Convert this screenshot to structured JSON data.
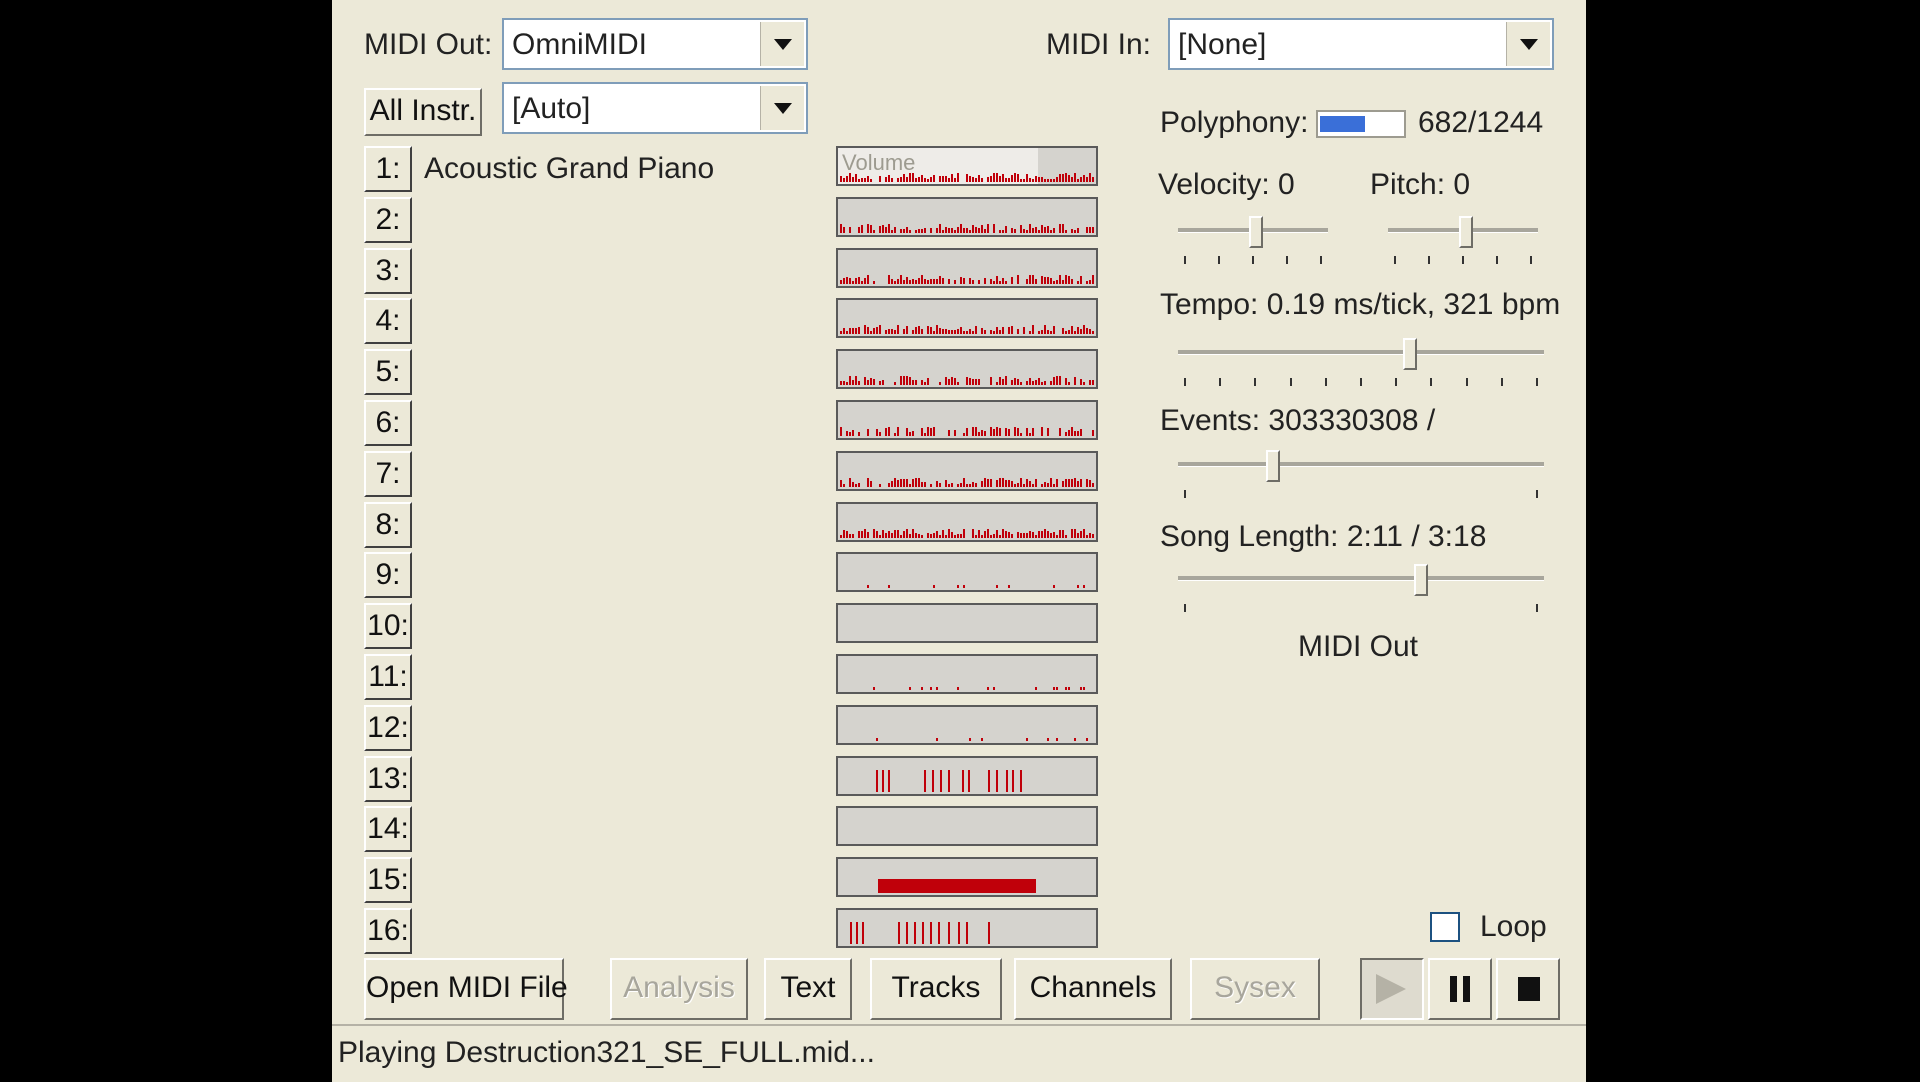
{
  "midi_out": {
    "label": "MIDI Out:",
    "value": "OmniMIDI"
  },
  "midi_in": {
    "label": "MIDI In:",
    "value": "[None]"
  },
  "all_instr_button": "All Instr.",
  "instrument_select": "[Auto]",
  "channels": [
    {
      "num": "1:",
      "instrument": "Acoustic Grand Piano"
    },
    {
      "num": "2:",
      "instrument": ""
    },
    {
      "num": "3:",
      "instrument": ""
    },
    {
      "num": "4:",
      "instrument": ""
    },
    {
      "num": "5:",
      "instrument": ""
    },
    {
      "num": "6:",
      "instrument": ""
    },
    {
      "num": "7:",
      "instrument": ""
    },
    {
      "num": "8:",
      "instrument": ""
    },
    {
      "num": "9:",
      "instrument": ""
    },
    {
      "num": "10:",
      "instrument": ""
    },
    {
      "num": "11:",
      "instrument": ""
    },
    {
      "num": "12:",
      "instrument": ""
    },
    {
      "num": "13:",
      "instrument": ""
    },
    {
      "num": "14:",
      "instrument": ""
    },
    {
      "num": "15:",
      "instrument": ""
    },
    {
      "num": "16:",
      "instrument": ""
    }
  ],
  "volume_label": "Volume",
  "polyphony": {
    "label": "Polyphony:",
    "value": "682/1244",
    "fraction": 0.55,
    "bar_color": "#3a6fd8"
  },
  "velocity": {
    "label": "Velocity: 0",
    "slider_fraction": 0.52
  },
  "pitch": {
    "label": "Pitch: 0",
    "slider_fraction": 0.52
  },
  "tempo": {
    "label": "Tempo: 0.19 ms/tick, 321 bpm",
    "slider_fraction": 0.64
  },
  "events": {
    "label": "Events: 303330308 /",
    "slider_fraction": 0.25
  },
  "song_length": {
    "label": "Song Length: 2:11 / 3:18",
    "slider_fraction": 0.67
  },
  "midi_out_caption": "MIDI Out",
  "loop": {
    "label": "Loop",
    "checked": false
  },
  "buttons": {
    "open": "Open MIDI File",
    "analysis": "Analysis",
    "text": "Text",
    "tracks": "Tracks",
    "channels": "Channels",
    "sysex": "Sysex"
  },
  "transport": {
    "play": "play-icon",
    "pause": "pause-icon",
    "stop": "stop-icon"
  },
  "status": "Playing Destruction321_SE_FULL.mid...",
  "colors": {
    "activity": "#c0000a",
    "window": "#ece9d8"
  }
}
